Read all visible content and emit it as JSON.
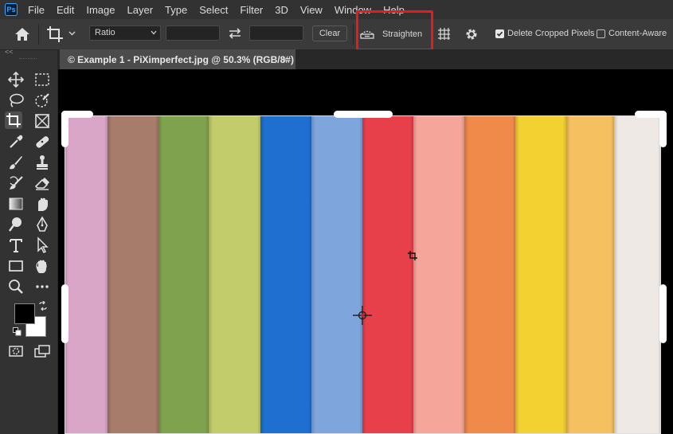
{
  "menubar": {
    "logo": "Ps",
    "items": [
      "File",
      "Edit",
      "Image",
      "Layer",
      "Type",
      "Select",
      "Filter",
      "3D",
      "View",
      "Window",
      "Help"
    ]
  },
  "options": {
    "ratio_value": "Ratio",
    "clear_label": "Clear",
    "straighten_label": "Straighten",
    "delete_cropped_label": "Delete Cropped Pixels",
    "delete_cropped_checked": true,
    "content_aware_label": "Content-Aware",
    "content_aware_checked": false,
    "highlight_color": "#e81b1b"
  },
  "toolbar": {
    "collapse": "<<",
    "foreground_color": "#000000",
    "background_color": "#ffffff"
  },
  "document": {
    "tab_title": "© Example 1 - PiXimperfect.jpg @ 50.3% (RGB/8#)",
    "close_glyph": "×",
    "stripe_colors": [
      "#d9a6c8",
      "#a87c6a",
      "#7fa24e",
      "#c2cc6a",
      "#1f6fd0",
      "#7fa6dc",
      "#e8404a",
      "#f5a59a",
      "#f08a4a",
      "#f3d130",
      "#f5c060",
      "#efe9e6"
    ]
  }
}
